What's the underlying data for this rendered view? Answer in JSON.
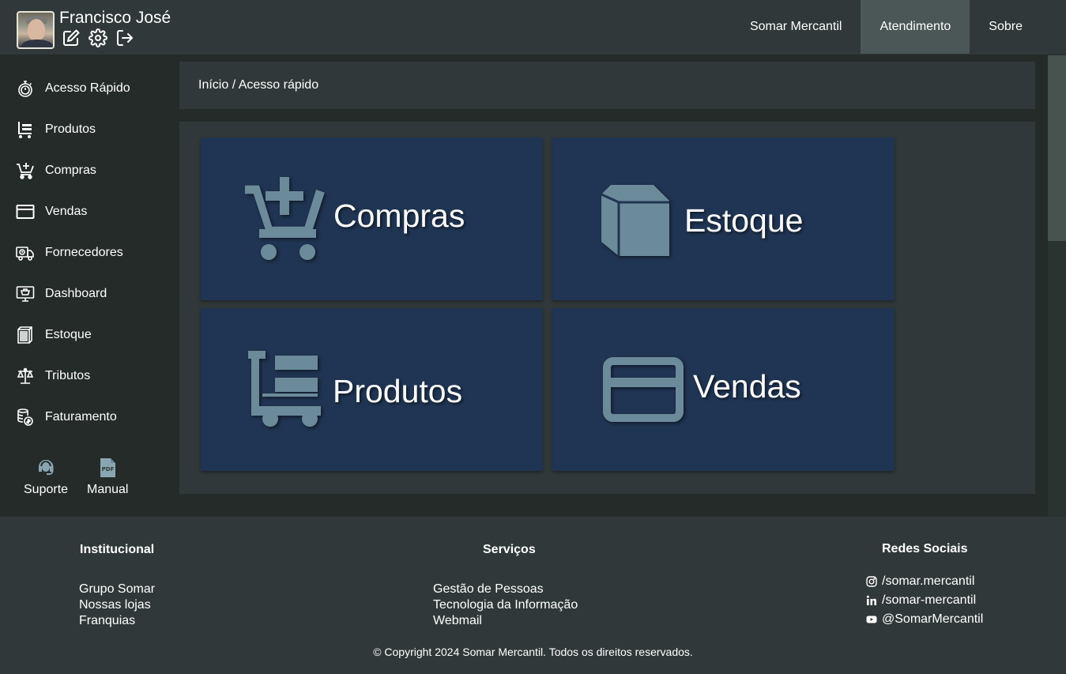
{
  "user": {
    "name": "Francisco José"
  },
  "header_icons": [
    "edit-icon",
    "gear-icon",
    "logout-icon"
  ],
  "topnav": [
    {
      "label": "Somar Mercantil",
      "active": false
    },
    {
      "label": "Atendimento",
      "active": true
    },
    {
      "label": "Sobre",
      "active": false
    }
  ],
  "sidebar": {
    "items": [
      {
        "label": "Acesso Rápido",
        "icon": "stopwatch-icon"
      },
      {
        "label": "Produtos",
        "icon": "cart-list-icon"
      },
      {
        "label": "Compras",
        "icon": "cart-plus-icon"
      },
      {
        "label": "Vendas",
        "icon": "credit-card-icon"
      },
      {
        "label": "Fornecedores",
        "icon": "truck-icon"
      },
      {
        "label": "Dashboard",
        "icon": "monitor-icon"
      },
      {
        "label": "Estoque",
        "icon": "box-icon"
      },
      {
        "label": "Tributos",
        "icon": "scale-icon"
      },
      {
        "label": "Faturamento",
        "icon": "coins-icon"
      }
    ],
    "bottom": [
      {
        "label": "Suporte",
        "icon": "headset-icon"
      },
      {
        "label": "Manual",
        "icon": "pdf-icon"
      }
    ]
  },
  "breadcrumb": "Início / Acesso rápido",
  "tiles": [
    {
      "label": "Compras",
      "icon": "cart-plus-icon"
    },
    {
      "label": "Estoque",
      "icon": "box-icon"
    },
    {
      "label": "Produtos",
      "icon": "cart-list-icon"
    },
    {
      "label": "Vendas",
      "icon": "credit-card-icon"
    }
  ],
  "footer": {
    "institucional": {
      "title": "Institucional",
      "links": [
        "Grupo Somar",
        "Nossas lojas",
        "Franquias"
      ]
    },
    "servicos": {
      "title": "Serviços",
      "links": [
        "Gestão de Pessoas",
        "Tecnologia da Informação",
        "Webmail"
      ]
    },
    "redes": {
      "title": "Redes Sociais",
      "links": [
        {
          "label": "/somar.mercantil",
          "icon": "instagram-icon"
        },
        {
          "label": "/somar-mercantil",
          "icon": "linkedin-icon"
        },
        {
          "label": "@SomarMercantil",
          "icon": "youtube-icon"
        }
      ]
    },
    "copyright": "© Copyright 2024 Somar Mercantil. Todos os direitos reservados."
  },
  "colors": {
    "tile": "#203553",
    "tile_icon": "#6b8a9a",
    "header": "#313839",
    "active_nav": "#4a5756"
  }
}
